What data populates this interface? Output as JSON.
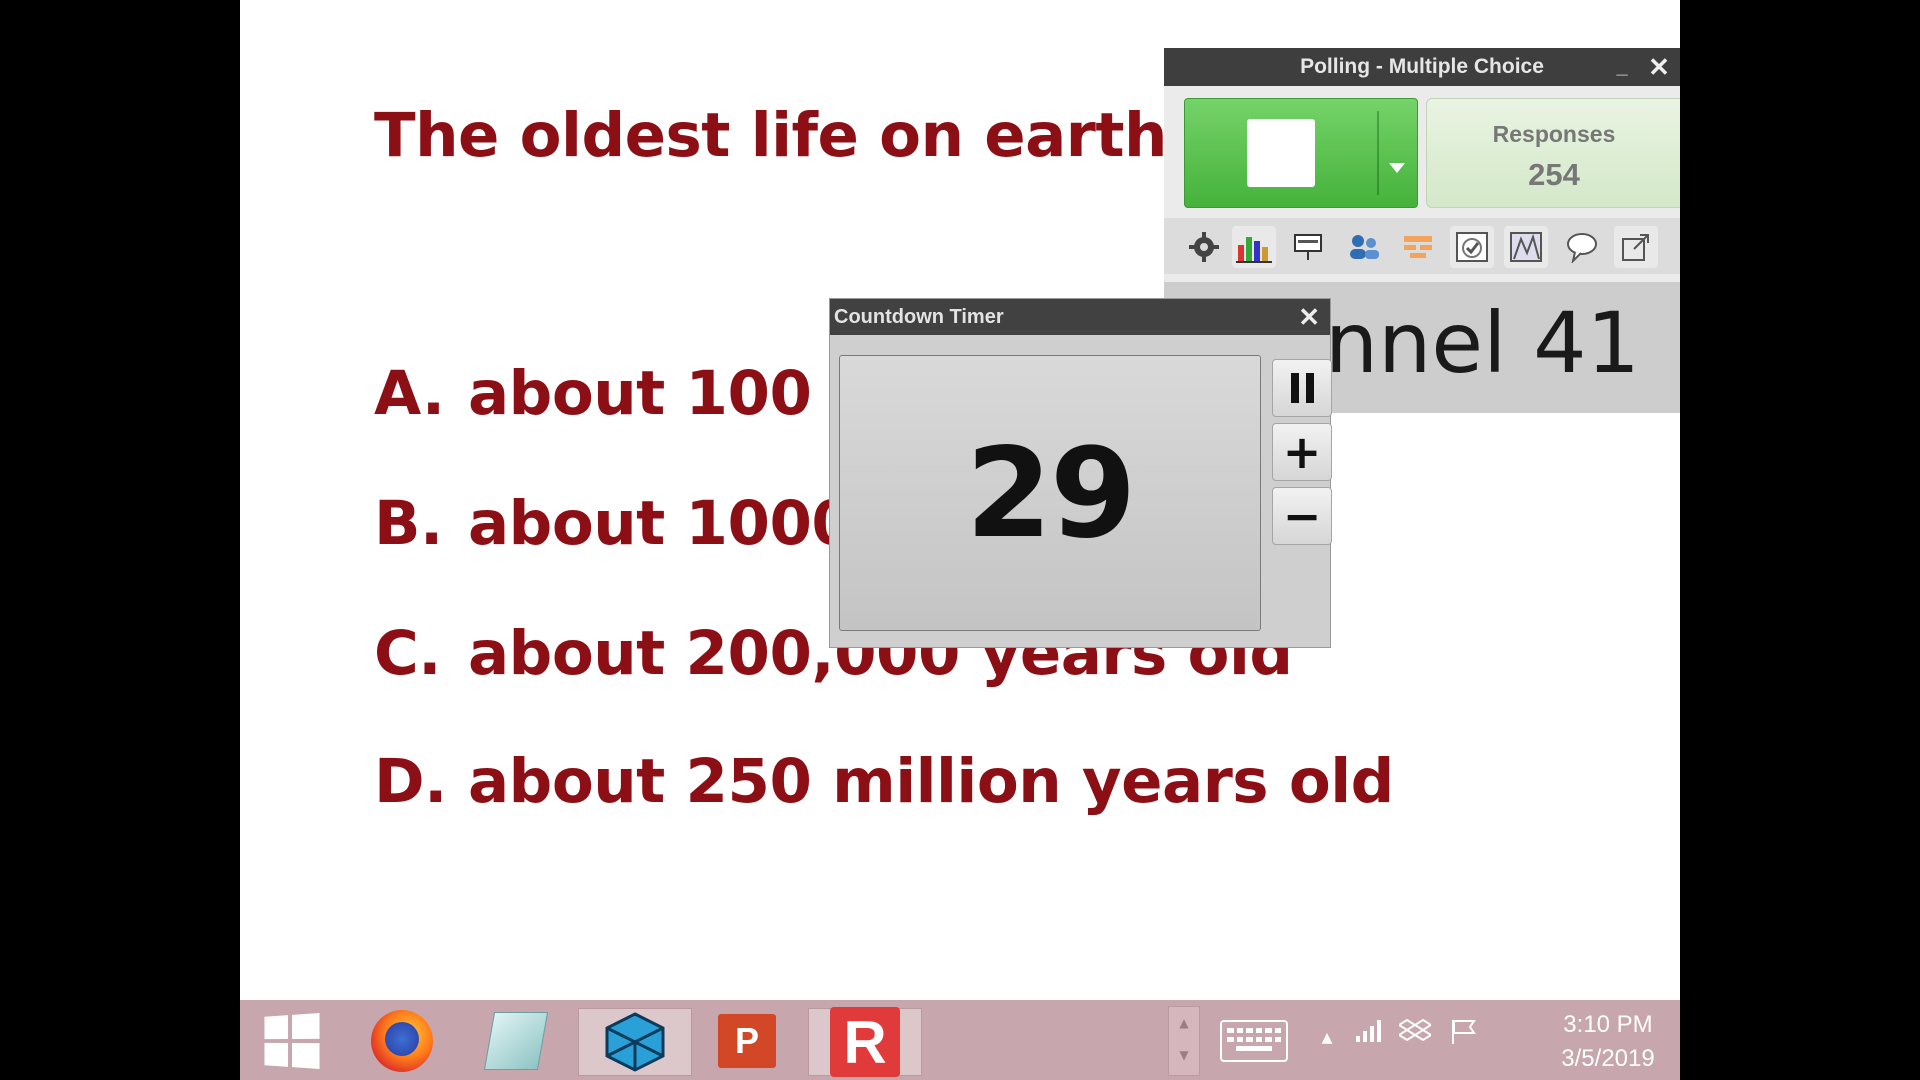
{
  "slide": {
    "question": "The oldest life on earth is",
    "options": [
      {
        "letter": "A.",
        "text": "about 100 years old"
      },
      {
        "letter": "B.",
        "text": "about 1000 years old"
      },
      {
        "letter": "C.",
        "text": "about 200,000 years old"
      },
      {
        "letter": "D.",
        "text": "about 250 million years old"
      }
    ],
    "text_color": "#8b0f14"
  },
  "polling": {
    "title": "Polling - Multiple Choice",
    "minimize_label": "_",
    "close_label": "✕",
    "responses_label": "Responses",
    "responses_count": "254",
    "channel_text": "Channel 41",
    "go_color": "#4cbb41",
    "toolbar_icons": [
      "gear-icon",
      "bar-chart-icon",
      "presentation-icon",
      "participants-icon",
      "grid-icon",
      "check-image-icon",
      "chart-image-icon",
      "speech-bubble-icon",
      "popout-icon"
    ]
  },
  "timer": {
    "title": "Countdown Timer",
    "close_label": "✕",
    "value": "29",
    "plus_label": "+",
    "minus_label": "−"
  },
  "taskbar": {
    "apps": [
      "windows-start-icon",
      "firefox-icon",
      "notepad-icon",
      "sketchup-icon",
      "powerpoint-icon",
      "response-app-icon"
    ],
    "ppt_label": "P",
    "response_label": "R",
    "tray_up": "▲",
    "time": "3:10 PM",
    "date": "3/5/2019"
  }
}
